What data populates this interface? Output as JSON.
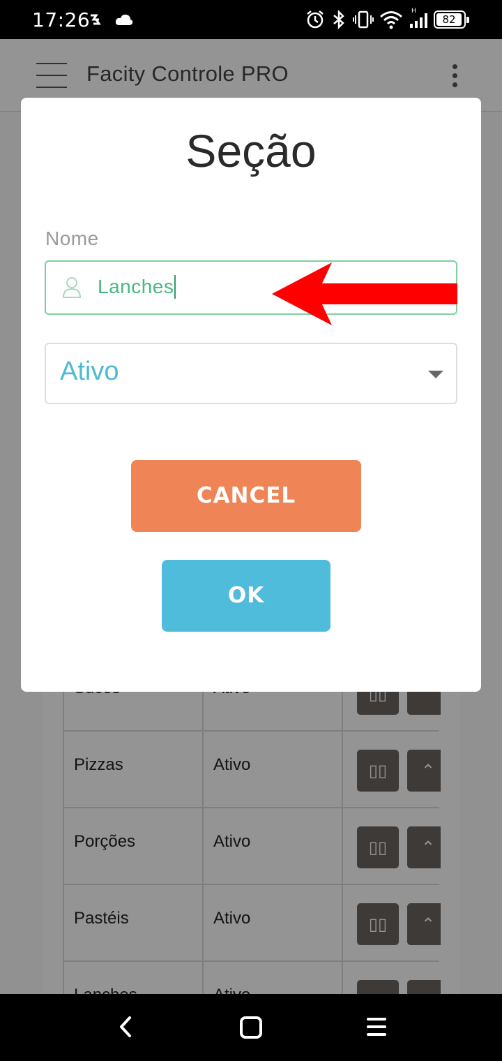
{
  "status_bar": {
    "time": "17:26",
    "battery": "82",
    "icons": [
      "data-saver-icon",
      "cloud-icon",
      "alarm-icon",
      "bluetooth-icon",
      "vibrate-icon",
      "wifi-icon",
      "signal-icon",
      "battery-icon"
    ]
  },
  "app_bar": {
    "title": "Facity Controle PRO",
    "icons": [
      "menu-icon",
      "more-vertical-icon"
    ]
  },
  "table": {
    "rows": [
      {
        "name": "Sucos",
        "status": "Ativo"
      },
      {
        "name": "Pizzas",
        "status": "Ativo"
      },
      {
        "name": "Porções",
        "status": "Ativo"
      },
      {
        "name": "Pastéis",
        "status": "Ativo"
      },
      {
        "name": "Lanches",
        "status": "Ativo"
      }
    ],
    "action_icons": [
      "pause-icon",
      "chevron-up-icon"
    ]
  },
  "dialog": {
    "title": "Seção",
    "name_label": "Nome",
    "name_value": "Lanches",
    "status_value": "Ativo",
    "cancel_label": "CANCEL",
    "ok_label": "OK"
  },
  "colors": {
    "cancel": "#ef8456",
    "ok": "#50bcdb",
    "input_border": "#7fcf9e",
    "input_text": "#48b882",
    "select_text": "#4fb9d4",
    "arrow": "#ff0000"
  },
  "nav_bar": {
    "icons": [
      "back-icon",
      "home-icon",
      "recents-icon"
    ]
  }
}
